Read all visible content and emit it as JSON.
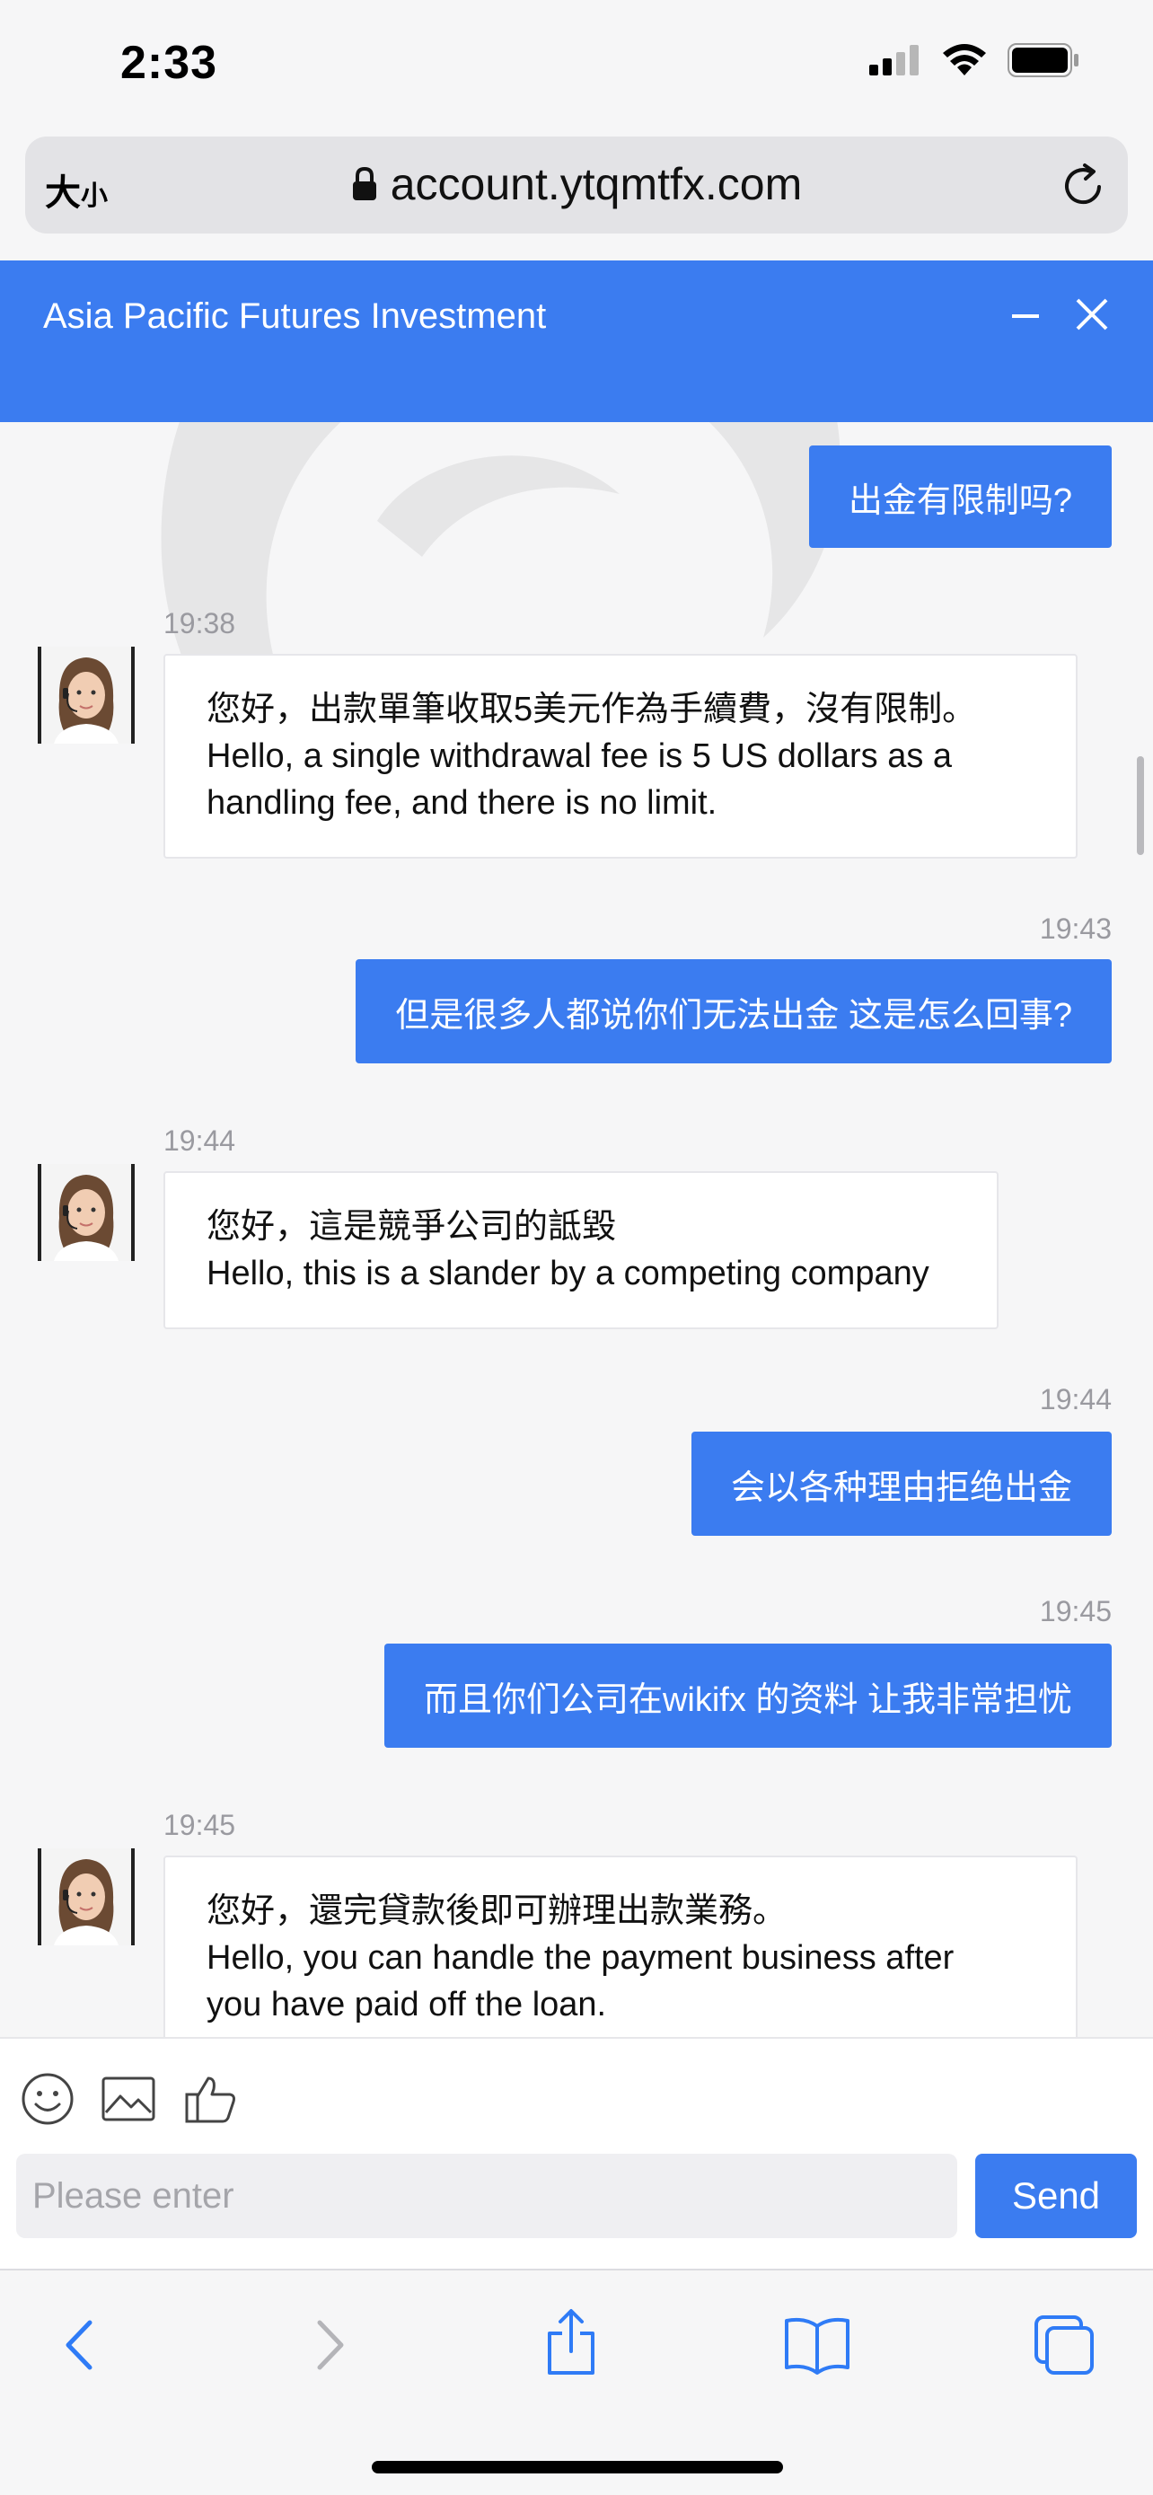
{
  "status_bar": {
    "time": "2:33"
  },
  "browser": {
    "text_size_label_big": "大",
    "text_size_label_small": "小",
    "url": "account.ytqmtfx.com"
  },
  "chat": {
    "title": "Asia Pacific Futures Investment",
    "messages": [
      {
        "direction": "outgoing",
        "time": "",
        "text": "出金有限制吗?"
      },
      {
        "direction": "incoming",
        "time": "19:38",
        "line1": "您好，出款單筆收取5美元作為手續費，沒有限制。",
        "line2": "Hello, a single withdrawal fee is 5 US dollars as a",
        "line3": "handling fee, and there is no limit."
      },
      {
        "direction": "outgoing",
        "time": "19:43",
        "text": "但是很多人都说你们无法出金 这是怎么回事?"
      },
      {
        "direction": "incoming",
        "time": "19:44",
        "line1": "您好，這是競爭公司的詆毀",
        "line2": "Hello, this is a slander by a competing company"
      },
      {
        "direction": "outgoing",
        "time": "19:44",
        "text": "会以各种理由拒绝出金"
      },
      {
        "direction": "outgoing",
        "time": "19:45",
        "text": "而且你们公司在wikifx 的资料 让我非常担忧"
      },
      {
        "direction": "incoming",
        "time": "19:45",
        "line1": "您好，還完貸款後即可辦理出款業務。",
        "line2": "Hello, you can handle the payment business after",
        "line3": "you have paid off the loan."
      }
    ]
  },
  "input": {
    "placeholder": "Please enter",
    "send_label": "Send"
  },
  "icons": {
    "emoji": "smile-icon",
    "image": "image-icon",
    "like": "thumbs-up-icon",
    "back": "chevron-left-icon",
    "forward": "chevron-right-icon",
    "share": "share-icon",
    "bookmarks": "book-icon",
    "tabs": "tabs-icon"
  },
  "colors": {
    "accent": "#3b7cf0",
    "safari_blue": "#2f7bf6",
    "background": "#f6f6f7"
  }
}
